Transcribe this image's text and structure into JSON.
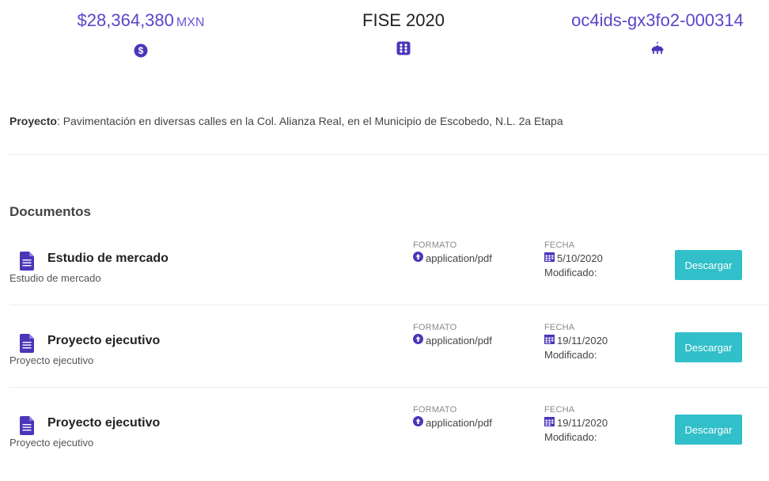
{
  "summary": {
    "amount": "$28,364,380",
    "currency": "MXN",
    "program": "FISE 2020",
    "ocid": "oc4ids-gx3fo2-000314",
    "icons": {
      "amount": "dollar-circle-icon",
      "program": "grid-dots-icon",
      "ocid": "building-dome-icon"
    }
  },
  "project": {
    "label": "Proyecto",
    "separator": ":",
    "text": " Pavimentación en diversas calles en la Col. Alianza Real, en el Municipio de Escobedo, N.L. 2a Etapa"
  },
  "documents": {
    "title": "Documentos",
    "format_label": "FORMATO",
    "date_label": "FECHA",
    "modified_label": "Modificado:",
    "download_label": "Descargar",
    "items": [
      {
        "title": "Estudio de mercado",
        "subtitle": "Estudio de mercado",
        "format": "application/pdf",
        "date": "5/10/2020"
      },
      {
        "title": "Proyecto ejecutivo",
        "subtitle": "Proyecto ejecutivo",
        "format": "application/pdf",
        "date": "19/11/2020"
      },
      {
        "title": "Proyecto ejecutivo",
        "subtitle": "Proyecto ejecutivo",
        "format": "application/pdf",
        "date": "19/11/2020"
      }
    ]
  },
  "colors": {
    "accent": "#5b46c9",
    "button": "#31bfc9",
    "divider": "#ececec"
  }
}
